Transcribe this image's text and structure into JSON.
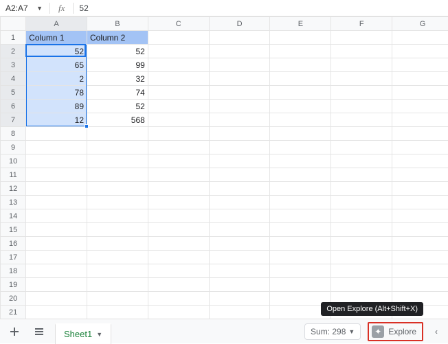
{
  "namebox": {
    "ref": "A2:A7"
  },
  "formula": {
    "value": "52"
  },
  "columns": [
    "A",
    "B",
    "C",
    "D",
    "E",
    "F",
    "G"
  ],
  "row_count": 23,
  "selected_col": "A",
  "selected_rows": [
    2,
    3,
    4,
    5,
    6,
    7
  ],
  "cells": {
    "header_row": 1,
    "headers": [
      "Column 1",
      "Column 2"
    ],
    "rows": [
      {
        "r": 2,
        "A": "52",
        "B": "52"
      },
      {
        "r": 3,
        "A": "65",
        "B": "99"
      },
      {
        "r": 4,
        "A": "2",
        "B": "32"
      },
      {
        "r": 5,
        "A": "78",
        "B": "74"
      },
      {
        "r": 6,
        "A": "89",
        "B": "52"
      },
      {
        "r": 7,
        "A": "12",
        "B": "568"
      }
    ]
  },
  "bottom": {
    "sheet_tab": "Sheet1",
    "sum_label": "Sum: 298",
    "explore_label": "Explore",
    "tooltip": "Open Explore (Alt+Shift+X)"
  },
  "chart_data": {
    "type": "table",
    "columns": [
      "Column 1",
      "Column 2"
    ],
    "rows": [
      [
        52,
        52
      ],
      [
        65,
        99
      ],
      [
        2,
        32
      ],
      [
        78,
        74
      ],
      [
        89,
        52
      ],
      [
        12,
        568
      ]
    ]
  }
}
